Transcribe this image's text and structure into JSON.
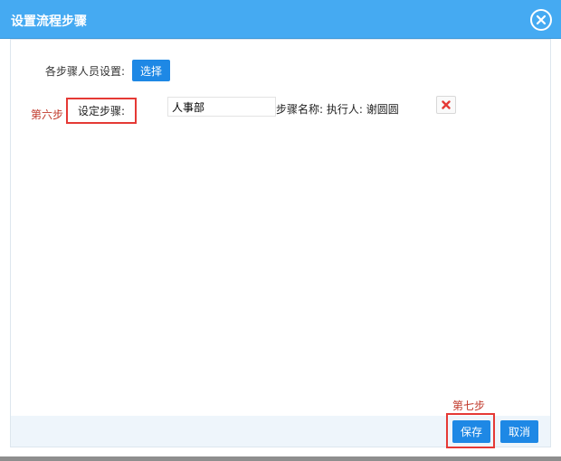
{
  "dialog": {
    "title": "设置流程步骤",
    "close_icon": "close-circle-icon"
  },
  "members": {
    "label": "各步骤人员设置:",
    "select_button": "选择"
  },
  "step": {
    "annotation": "第六步",
    "label": "设定步骤:",
    "department_value": "人事部",
    "name_info": "步骤名称:  执行人:  谢圆圆",
    "delete_icon": "delete-x-icon"
  },
  "footer": {
    "annotation": "第七步",
    "save_button": "保存",
    "cancel_button": "取消"
  },
  "colors": {
    "titlebar": "#45aaf2",
    "button": "#1e88e5",
    "highlight": "#e53935",
    "annotation": "#c0392b"
  }
}
